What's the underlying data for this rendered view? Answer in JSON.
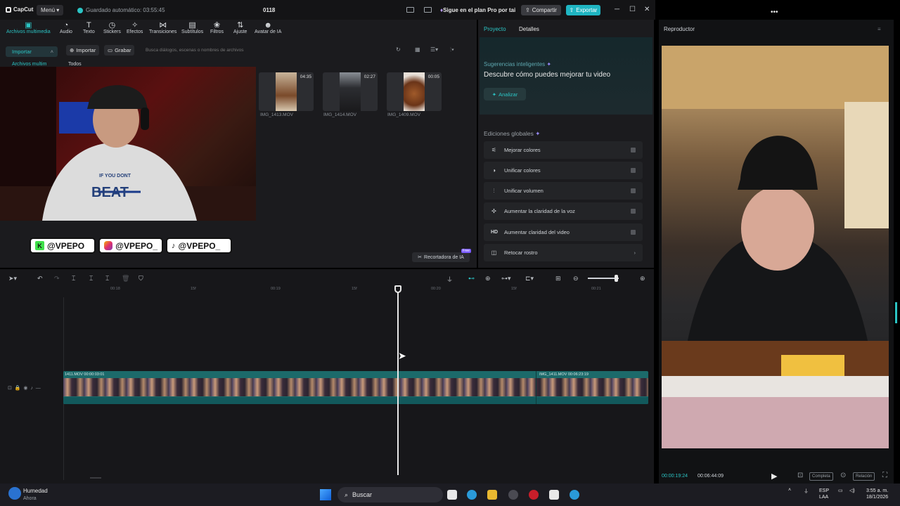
{
  "titlebar": {
    "app_name": "CapCut",
    "menu_label": "Menú",
    "autosave": "Guardado automático: 03:55:45",
    "project_name": "0118",
    "pro_promo": "Sigue en el plan Pro por tai",
    "share_label": "Compartir",
    "export_label": "Exportar"
  },
  "toolbar": {
    "items": [
      "Archivos multimedia",
      "Audio",
      "Texto",
      "Stickers",
      "Efectos",
      "Transiciones",
      "Subtítulos",
      "Filtros",
      "Ajuste",
      "Avatar de IA"
    ]
  },
  "media": {
    "import_tab": "Importar",
    "local_tab": "Archivos multim",
    "all_label": "Todos",
    "import_button": "Importar",
    "record_button": "Grabar",
    "search_placeholder": "Busca diálogos, escenas o nombres de archivos",
    "clips": [
      {
        "name": "IMG_1413.MOV",
        "duration": "04:35"
      },
      {
        "name": "IMG_1414.MOV",
        "duration": "02:27"
      },
      {
        "name": "IMG_1409.MOV",
        "duration": "00:05"
      }
    ],
    "ai_cutter": "Recortadora de IA",
    "ai_cutter_badge": "Free"
  },
  "overlay": {
    "socials": [
      "@VPEPO",
      "@VPEPO_",
      "@VPEPO_"
    ],
    "shirt_text_1": "IF YOU DONT",
    "shirt_text_2": "BEAT"
  },
  "panel": {
    "tabs": [
      "Proyecto",
      "Detalles"
    ],
    "smart_title": "Sugerencias inteligentes",
    "smart_heading": "Descubre cómo puedes mejorar tu video",
    "analyze_button": "Analizar",
    "global_title": "Ediciones globales",
    "edits": [
      "Mejorar colores",
      "Unificar colores",
      "Unificar volumen",
      "Aumentar la claridad de la voz",
      "Aumentar claridad del video",
      "Retocar rostro"
    ]
  },
  "timeline": {
    "ruler": [
      "00:18",
      "15f",
      "00:19",
      "15f",
      "00:20",
      "15f",
      "00:21"
    ],
    "clip1_label": "1411.MOV  00:00:03:01",
    "clip2_label": "IMG_1411.MOV  00:06:23:19"
  },
  "player": {
    "title": "Reproductor",
    "current_time": "00:00:19:24",
    "total_time": "00:06:44:09",
    "full_label": "Completa",
    "ratio_label": "Relación"
  },
  "taskbar": {
    "weather_title": "Humedad",
    "weather_sub": "Ahora",
    "search_label": "Buscar",
    "lang_1": "ESP",
    "lang_2": "LAA",
    "time": "3:55 a. m.",
    "date": "18/1/2026"
  },
  "colors": {
    "accent": "#2bc4c4",
    "bg": "#1b1b1e",
    "track": "#1c6a6a"
  }
}
